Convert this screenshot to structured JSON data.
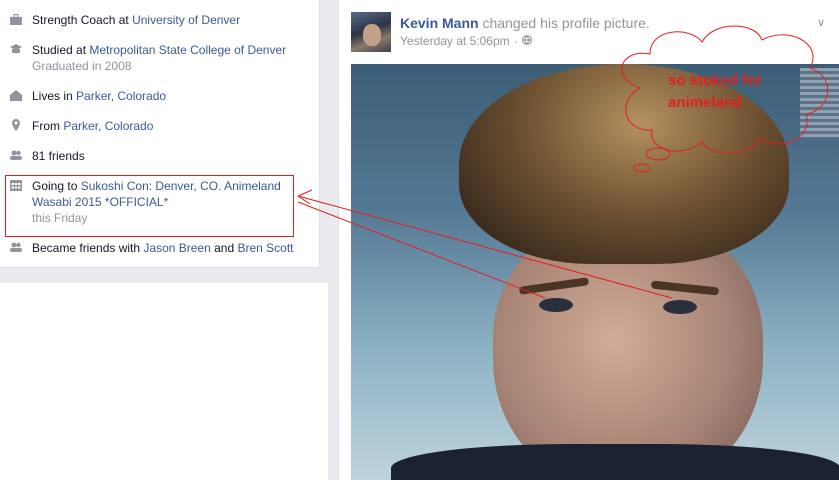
{
  "intro": {
    "work": {
      "prefix": "Strength Coach at ",
      "link": "University of Denver"
    },
    "education": {
      "prefix": "Studied at ",
      "link": "Metropolitan State College of Denver",
      "sub": "Graduated in 2008"
    },
    "lives": {
      "prefix": "Lives in ",
      "link": "Parker, Colorado"
    },
    "from": {
      "prefix": "From ",
      "link": "Parker, Colorado"
    },
    "friends": {
      "text": "81 friends"
    },
    "event": {
      "prefix": "Going to ",
      "link": "Sukoshi Con: Denver, CO. Animeland Wasabi 2015 *OFFICIAL*",
      "sub": "this Friday"
    },
    "became": {
      "prefix": "Became friends with ",
      "link1": "Jason Breen",
      "mid": " and ",
      "link2": "Bren Scott"
    }
  },
  "post": {
    "author": "Kevin Mann",
    "action": " changed his profile picture.",
    "timestamp": "Yesterday at 5:06pm",
    "separator": "·"
  },
  "annotation": {
    "cloud_text": "so stoked for animeland",
    "color": "#e02020"
  },
  "colors": {
    "link": "#3b5998",
    "muted": "#90949c",
    "background": "#e9ebee"
  }
}
